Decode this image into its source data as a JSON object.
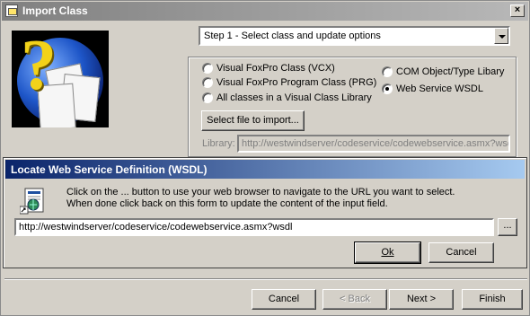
{
  "window": {
    "title": "Import Class",
    "close_glyph": "×"
  },
  "step_combo": {
    "value": "Step 1 - Select class and update options"
  },
  "options": {
    "left": [
      {
        "label": "Visual  FoxPro Class (VCX)",
        "selected": false
      },
      {
        "label": "Visual FoxPro Program Class (PRG)",
        "selected": false
      },
      {
        "label": "All classes in a Visual Class Library",
        "selected": false
      }
    ],
    "right": [
      {
        "label": "COM Object/Type Libary",
        "selected": false
      },
      {
        "label": "Web Service WSDL",
        "selected": true
      }
    ]
  },
  "select_file_button": "Select file to import...",
  "library": {
    "label": "Library:",
    "value": "http://westwindserver/codeservice/codewebservice.asmx?wsdl"
  },
  "dialog": {
    "title": "Locate Web Service Definition (WSDL)",
    "message_line1": "Click on the ... button to use your web browser to navigate to the URL you want to select.",
    "message_line2": "When done click back on this form to update the content of the input field.",
    "url_value": "http://westwindserver/codeservice/codewebservice.asmx?wsdl",
    "browse_label": "...",
    "ok_label": "Ok",
    "cancel_label": "Cancel"
  },
  "footer": {
    "cancel_label": "Cancel",
    "back_label": "< Back",
    "next_label": "Next >",
    "finish_label": "Finish"
  }
}
